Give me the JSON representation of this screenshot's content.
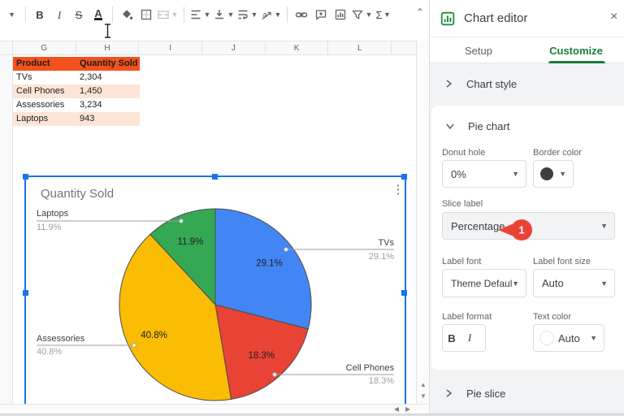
{
  "toolbar": {
    "items": [
      {
        "id": "toolbar-overflow",
        "caretOnly": true
      },
      {
        "id": "divider-1",
        "divider": true
      },
      {
        "id": "bold",
        "glyph": "B",
        "style": "bold"
      },
      {
        "id": "italic",
        "glyph": "I",
        "style": "italic"
      },
      {
        "id": "strikethrough",
        "glyph": "S",
        "style": "strike"
      },
      {
        "id": "text-color",
        "glyph": "A",
        "style": "textcolor"
      },
      {
        "id": "divider-2",
        "divider": true
      },
      {
        "id": "fill-color",
        "svg": true
      },
      {
        "id": "borders",
        "svg": true
      },
      {
        "id": "merge-cells",
        "svg": true,
        "caret": true,
        "disabled": true
      },
      {
        "id": "divider-3",
        "divider": true
      },
      {
        "id": "horizontal-align",
        "svg": true,
        "caret": true
      },
      {
        "id": "vertical-align",
        "svg": true,
        "caret": true
      },
      {
        "id": "text-wrap",
        "svg": true,
        "caret": true
      },
      {
        "id": "text-rotation",
        "svg": true,
        "caret": true
      },
      {
        "id": "divider-4",
        "divider": true
      },
      {
        "id": "insert-link",
        "svg": true
      },
      {
        "id": "insert-comment",
        "svg": true
      },
      {
        "id": "insert-chart",
        "svg": true
      },
      {
        "id": "create-filter",
        "svg": true,
        "caret": true
      },
      {
        "id": "functions",
        "glyph": "Σ",
        "caret": true
      }
    ],
    "collapse_glyph": "⌃"
  },
  "sheet": {
    "columns": [
      "G",
      "H",
      "I",
      "J",
      "K",
      "L"
    ],
    "table": {
      "headers": [
        "Product",
        "Quantity Sold"
      ],
      "rows": [
        [
          "TVs",
          "2,304"
        ],
        [
          "Cell Phones",
          "1,450"
        ],
        [
          "Assessories",
          "3,234"
        ],
        [
          "Laptops",
          "943"
        ]
      ],
      "header_bg": "#f4511e",
      "band_bg": "#fce5d6"
    }
  },
  "chart": {
    "title": "Quantity Sold",
    "menu_glyph": "⋮",
    "callouts": [
      {
        "label": "Laptops",
        "value": "11.9%"
      },
      {
        "label": "TVs",
        "value": "29.1%"
      },
      {
        "label": "Assessories",
        "value": "40.8%"
      },
      {
        "label": "Cell Phones",
        "value": "18.3%"
      }
    ]
  },
  "chart_data": {
    "type": "pie",
    "title": "Quantity Sold",
    "categories": [
      "TVs",
      "Cell Phones",
      "Assessories",
      "Laptops"
    ],
    "values": [
      2304,
      1450,
      3234,
      943
    ],
    "percentages": [
      29.1,
      18.3,
      40.8,
      11.9
    ],
    "percent_labels": [
      "29.1%",
      "18.3%",
      "40.8%",
      "11.9%"
    ],
    "colors": [
      "#4285f4",
      "#e94335",
      "#fbbc04",
      "#34a853"
    ],
    "slice_border_color": "#4d4d4d",
    "slice_label_mode": "Percentage",
    "legend": "labeled-callouts",
    "start_angle_deg": 0,
    "direction": "clockwise"
  },
  "panel": {
    "title": "Chart editor",
    "close_glyph": "×",
    "tabs": [
      {
        "label": "Setup",
        "active": false
      },
      {
        "label": "Customize",
        "active": true
      }
    ],
    "sections": {
      "chart_style": "Chart style",
      "pie_chart": "Pie chart",
      "pie_slice": "Pie slice"
    },
    "fields": {
      "donut_hole": {
        "label": "Donut hole",
        "value": "0%"
      },
      "border_color": {
        "label": "Border color",
        "value_color": "#3c4043"
      },
      "slice_label": {
        "label": "Slice label",
        "value": "Percentage"
      },
      "label_font": {
        "label": "Label font",
        "value": "Theme Defaul…"
      },
      "label_font_size": {
        "label": "Label font size",
        "value": "Auto"
      },
      "label_format": {
        "label": "Label format",
        "bold_glyph": "B",
        "italic_glyph": "I"
      },
      "text_color": {
        "label": "Text color",
        "value": "Auto"
      }
    },
    "annotation_badge": {
      "number": "1",
      "color": "#ea4335"
    }
  },
  "colors": {
    "selection_blue": "#1a73e8",
    "accent_green": "#188038",
    "header_orange": "#f4511e",
    "band_pink": "#fce5d6"
  }
}
